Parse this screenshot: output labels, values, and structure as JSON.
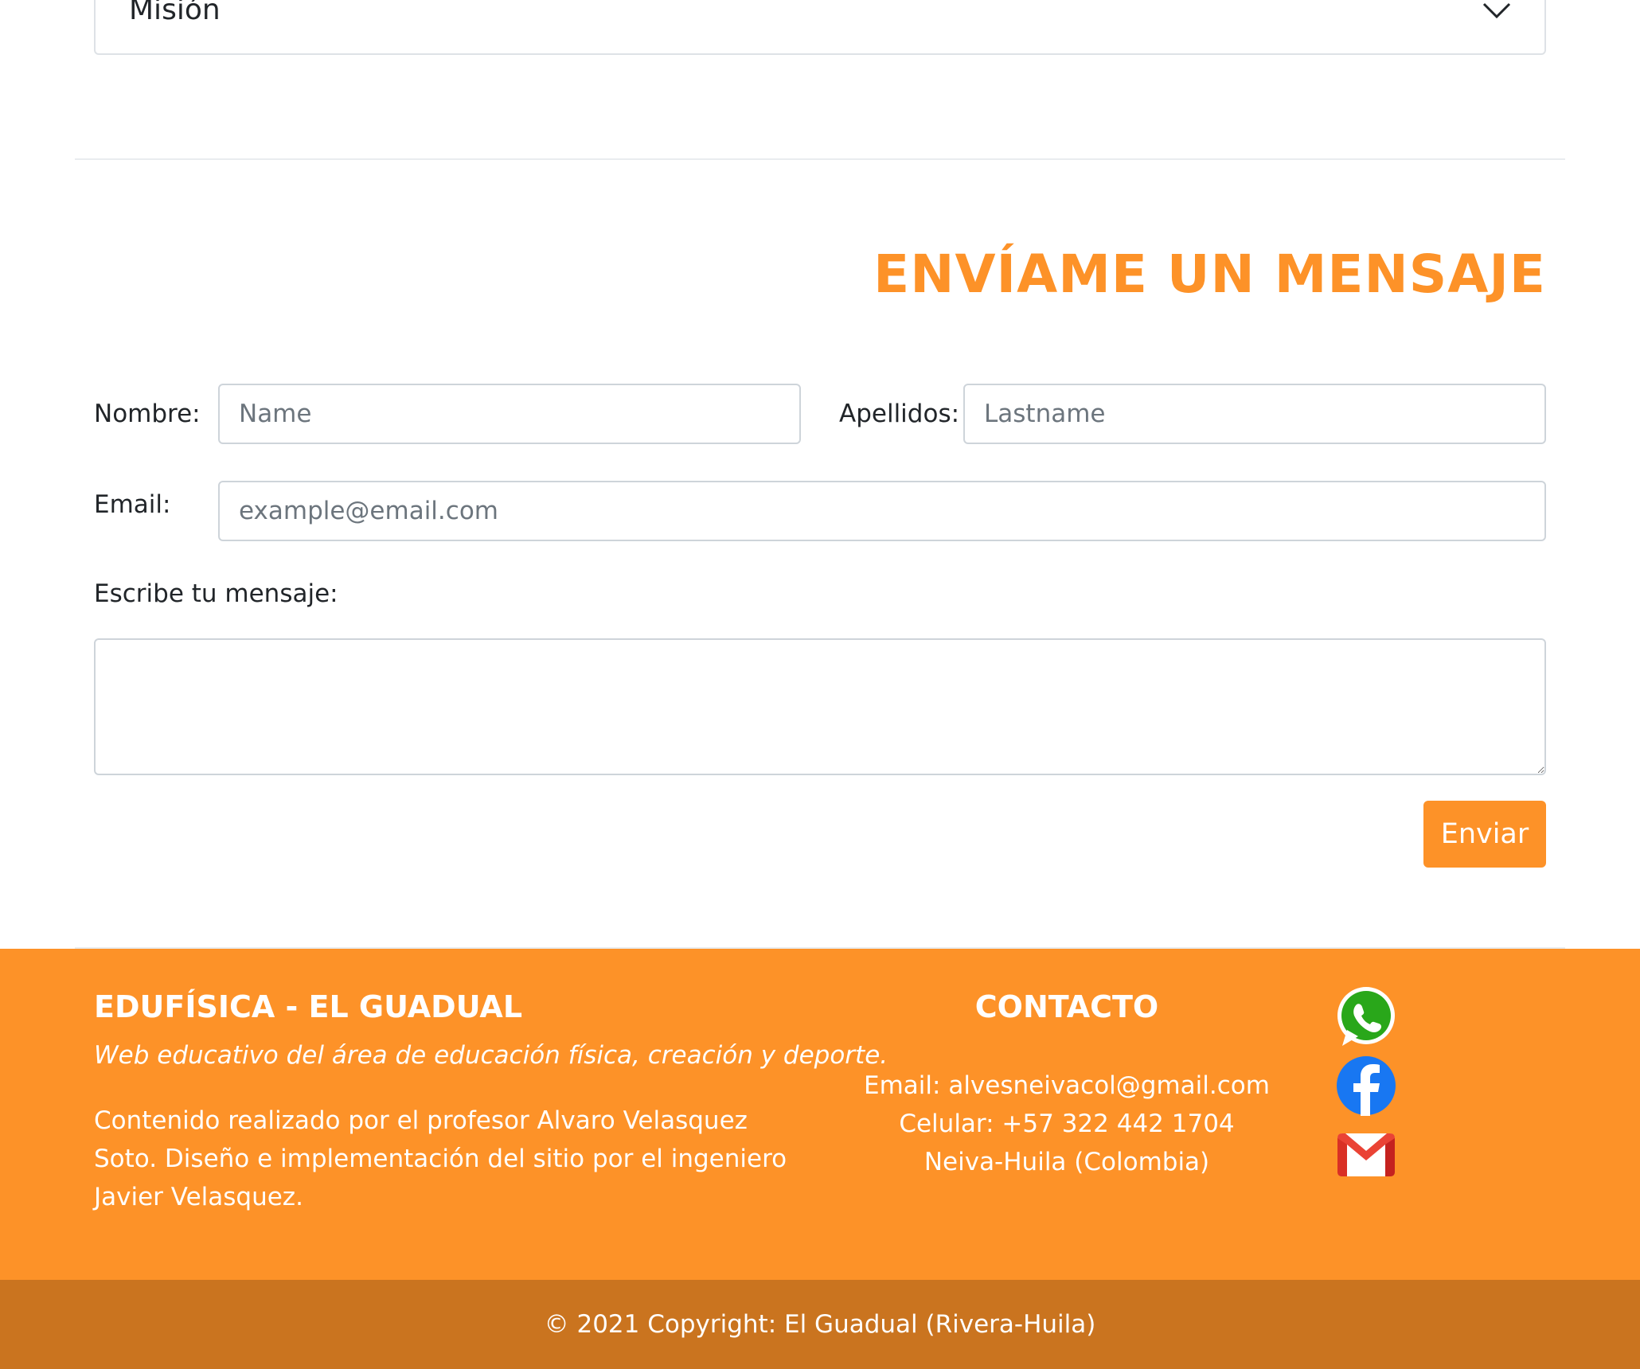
{
  "accordion": {
    "label": "Misión",
    "icon": "chevron-down-icon"
  },
  "contact_form": {
    "title": "ENVÍAME UN MENSAJE",
    "name_label": "Nombre:",
    "name_placeholder": "Name",
    "lastname_label": "Apellidos:",
    "lastname_placeholder": "Lastname",
    "email_label": "Email:",
    "email_placeholder": "example@email.com",
    "message_label": "Escribe tu mensaje:",
    "submit_label": "Enviar"
  },
  "footer": {
    "brand": "EDUFÍSICA - EL GUADUAL",
    "tagline": "Web educativo del área de educación física, creación y deporte.",
    "credits": "Contenido realizado por el profesor Alvaro Velasquez Soto. Diseño e implementación del sitio por el ingeniero Javier Velasquez.",
    "contact_title": "CONTACTO",
    "contact_email": "Email: alvesneivacol@gmail.com",
    "contact_phone": "Celular: +57 322 442 1704",
    "contact_location": "Neiva-Huila (Colombia)",
    "social_icons": [
      "whatsapp-icon",
      "facebook-icon",
      "gmail-icon"
    ]
  },
  "copyright": "© 2021 Copyright: El Guadual (Rivera-Huila)",
  "colors": {
    "accent": "#fd9228",
    "footer_bottom": "#ca741f",
    "text": "#212529",
    "border": "#ced4da"
  }
}
